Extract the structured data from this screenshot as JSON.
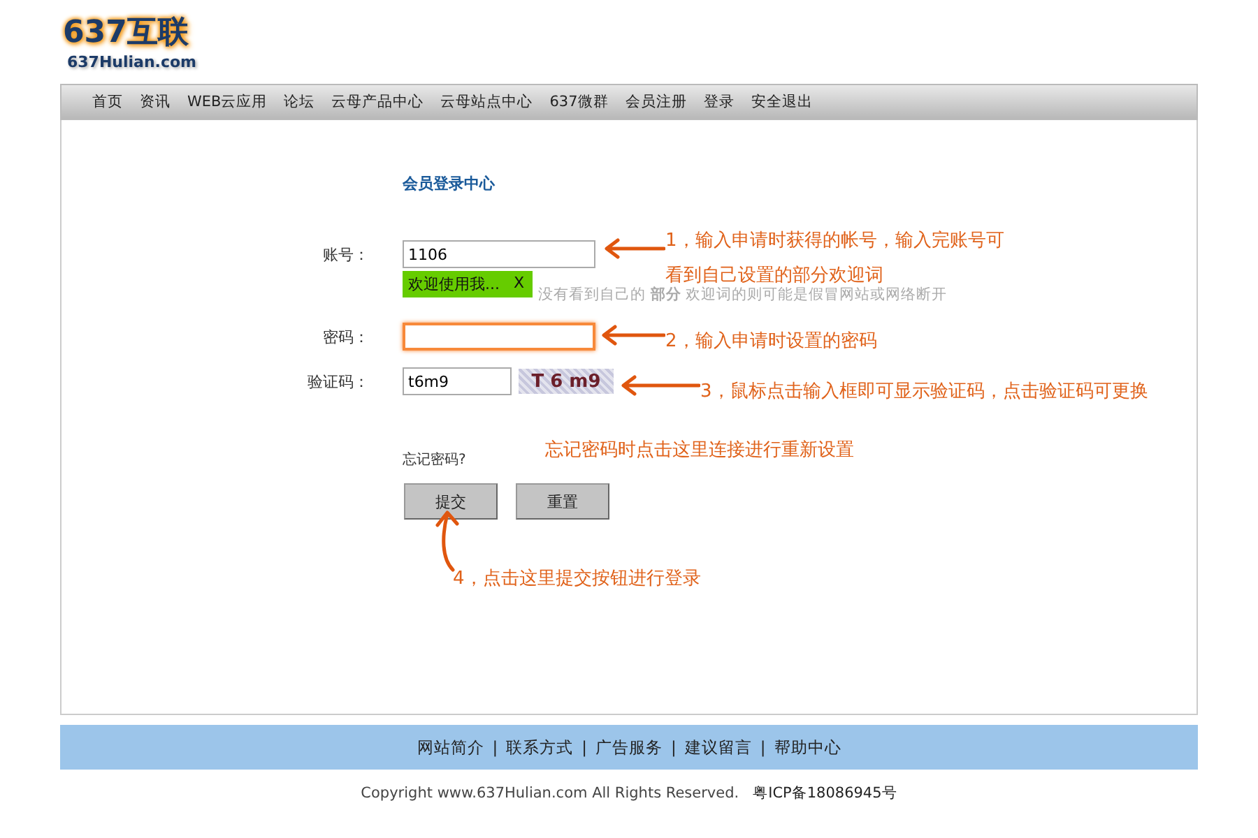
{
  "logo": {
    "title": "637互联",
    "subtitle": "637Hulian.com"
  },
  "nav": [
    "首页",
    "资讯",
    "WEB云应用",
    "论坛",
    "云母产品中心",
    "云母站点中心",
    "637微群",
    "会员注册",
    "登录",
    "安全退出"
  ],
  "form": {
    "heading": "会员登录中心",
    "fields": [
      {
        "kind": "account",
        "label": "账号：",
        "value": "1106",
        "focused": false
      },
      {
        "kind": "password",
        "label": "密码：",
        "focused": true
      },
      {
        "kind": "captcha",
        "label": "验证码：",
        "value": "t6m9",
        "focused": false,
        "captcha": "T 6 m9"
      }
    ],
    "tooltip": {
      "text": "欢迎使用我...",
      "close": "X"
    },
    "hint": "没有看到自己的 **部分** 欢迎词的则可能是假冒网站或网络断开",
    "forgot": "忘记密码?",
    "buttons": [
      "提交",
      "重置"
    ]
  },
  "annotations": [
    {
      "kind": "left",
      "lines": [
        "1，输入申请时获得的帐号，输入完账号可",
        "看到自己设置的部分欢迎词"
      ]
    },
    {
      "kind": "left",
      "lines": [
        "2，输入申请时设置的密码"
      ]
    },
    {
      "kind": "left",
      "lines": [
        "3，鼠标点击输入框即可显示验证码，点击验证码可更换"
      ]
    },
    {
      "kind": "plain",
      "lines": [
        "忘记密码时点击这里连接进行重新设置"
      ]
    },
    {
      "kind": "up",
      "lines": [
        "4，点击这里提交按钮进行登录"
      ]
    }
  ],
  "footer": {
    "separator": "|",
    "links": [
      "网站简介",
      "联系方式",
      "广告服务",
      "建议留言",
      "帮助中心"
    ],
    "copyright": "Copyright www.637Hulian.com All Rights Reserved.",
    "icp": "粤ICP备18086945号"
  }
}
